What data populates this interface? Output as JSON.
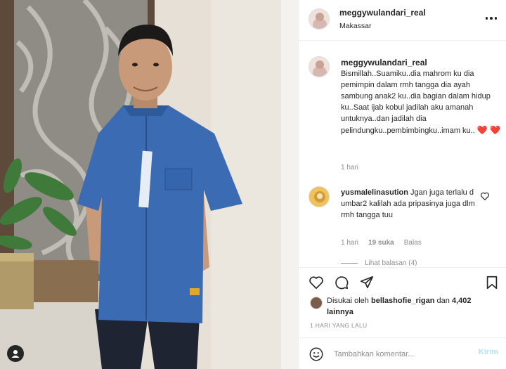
{
  "post": {
    "username": "meggywulandari_real",
    "location": "Makassar"
  },
  "caption": {
    "username": "meggywulandari_real",
    "text": "Bismillah..Suamiku..dia mahrom ku dia pemimpin dalam rmh tangga dia ayah sambung anak2 ku..dia bagian dalam hidup ku..Saat ijab kobul jadilah aku amanah untuknya..dan jadilah dia pelindungku..pembimbingku..imam ku..",
    "emoji": "❤️ ❤️",
    "time": "1 hari"
  },
  "comment": {
    "username": "yusmalelinasution",
    "text": "Jgan juga terlalu d umbar2 kalilah ada pripasinya juga dlm rmh tangga tuu",
    "time": "1 hari",
    "likes": "19 suka",
    "reply_label": "Balas",
    "view_replies": "Lihat balasan (4)"
  },
  "likes": {
    "prefix": "Disukai oleh",
    "liker": "bellashofie_rigan",
    "conjunction": "dan",
    "others": "4,402 lainnya"
  },
  "date": "1 HARI YANG LALU",
  "add_comment": {
    "placeholder": "Tambahkan komentar...",
    "post_label": "Kirim"
  },
  "colors": {
    "heart": "#e0203c",
    "link_disabled": "#b2dffc",
    "shirt": "#3b6bb3",
    "muted": "#8e8e8e"
  },
  "icons": [
    "user-tag-icon",
    "more-options-icon",
    "heart-icon",
    "comment-icon",
    "share-icon",
    "bookmark-icon",
    "emoji-icon",
    "comment-like-icon"
  ]
}
